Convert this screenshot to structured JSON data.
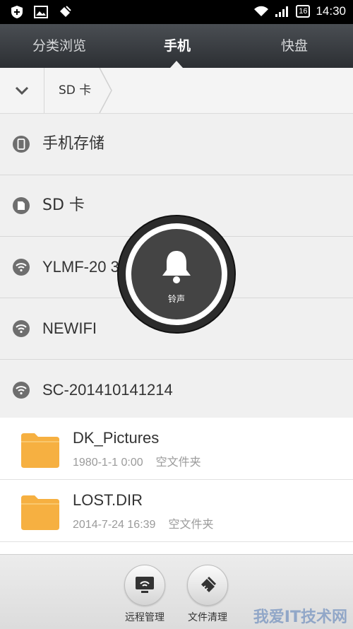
{
  "statusbar": {
    "time": "14:30",
    "battery": "16"
  },
  "tabs": [
    {
      "label": "分类浏览",
      "active": false
    },
    {
      "label": "手机",
      "active": true
    },
    {
      "label": "快盘",
      "active": false
    }
  ],
  "breadcrumb": {
    "current": "SD 卡"
  },
  "storage": [
    {
      "label": "手机存储",
      "icon": "phone-icon"
    },
    {
      "label": "SD 卡",
      "icon": "sd-card-icon"
    },
    {
      "label": "YLMF-20  3100  70",
      "icon": "wifi-icon"
    },
    {
      "label": "NEWIFI",
      "icon": "wifi-icon"
    },
    {
      "label": "SC-201410141214",
      "icon": "wifi-icon"
    }
  ],
  "files": [
    {
      "name": "DK_Pictures",
      "date": "1980-1-1 0:00",
      "tag": "空文件夹"
    },
    {
      "name": "LOST.DIR",
      "date": "2014-7-24 16:39",
      "tag": "空文件夹"
    }
  ],
  "bottom": {
    "remote_label": "远程管理",
    "clean_label": "文件清理"
  },
  "overlay": {
    "label": "铃声",
    "icon": "bell-icon"
  },
  "watermark": "我爱IT技术网",
  "colors": {
    "folder": "#f6b041",
    "tabbar": "#33373b",
    "icon_gray": "#6e6e6e"
  }
}
